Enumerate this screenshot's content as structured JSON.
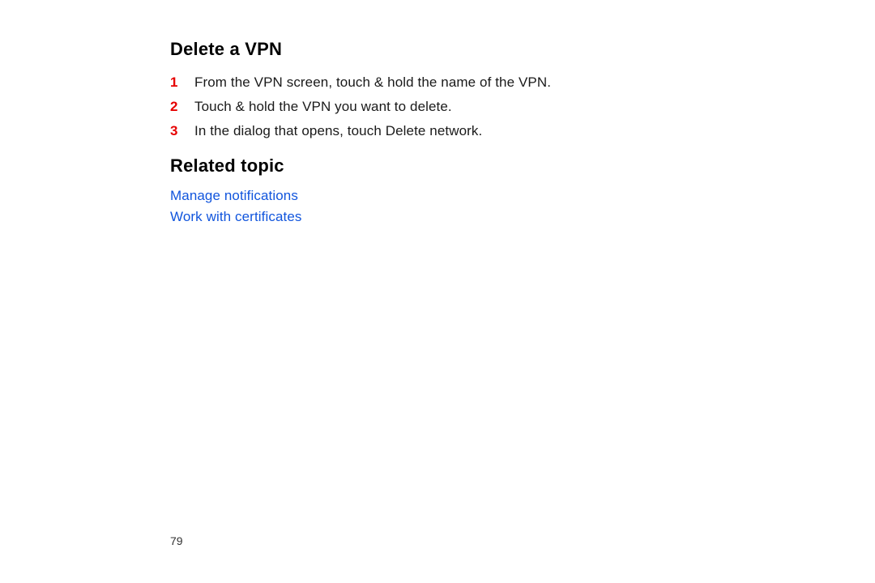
{
  "section1": {
    "title": "Delete a VPN",
    "steps": [
      {
        "num": "1",
        "text": "From the VPN screen, touch & hold the name of the VPN."
      },
      {
        "num": "2",
        "text": "Touch & hold the VPN you want to delete."
      },
      {
        "num": "3",
        "text": "In the dialog that opens, touch Delete network."
      }
    ]
  },
  "section2": {
    "title": "Related topic",
    "links": [
      {
        "label": "Manage notifications"
      },
      {
        "label": "Work with certificates"
      }
    ]
  },
  "pageNumber": "79"
}
